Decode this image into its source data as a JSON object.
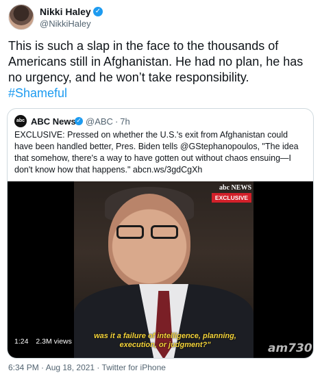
{
  "author": {
    "name": "Nikki Haley",
    "handle": "@NikkiHaley",
    "verified_icon": "verified-check-icon"
  },
  "tweet": {
    "text": "This is such a slap in the face to the thousands of Americans still in Afghanistan. He had no plan, he has no urgency, and he won’t take responsibility.",
    "hashtag": "#Shameful"
  },
  "quoted": {
    "logo_text": "abc",
    "name": "ABC News",
    "handle": "@ABC",
    "separator": "·",
    "time": "7h",
    "text": "EXCLUSIVE: Pressed on whether the U.S.'s exit from Afghanistan could have been handled better, Pres. Biden tells @GStephanopoulos, \"The idea that somehow, there's a way to have gotten out without chaos ensuing—I don't know how that happens.\" abcn.ws/3gdCgXh",
    "video": {
      "network_badge": "abc NEWS",
      "exclusive_label": "EXCLUSIVE",
      "caption": "was it a failure of intelligence, planning, execution, or judgment?\"",
      "duration": "1:24",
      "views": "2.3M views",
      "watermark": "am730"
    }
  },
  "footer": {
    "timestamp": "6:34 PM · Aug 18, 2021 · Twitter for iPhone"
  },
  "colors": {
    "accent": "#1d9bf0",
    "secondary_text": "#536471",
    "border": "#cfd9de",
    "caption": "#f6d53a",
    "exclusive_red": "#d3202a"
  }
}
